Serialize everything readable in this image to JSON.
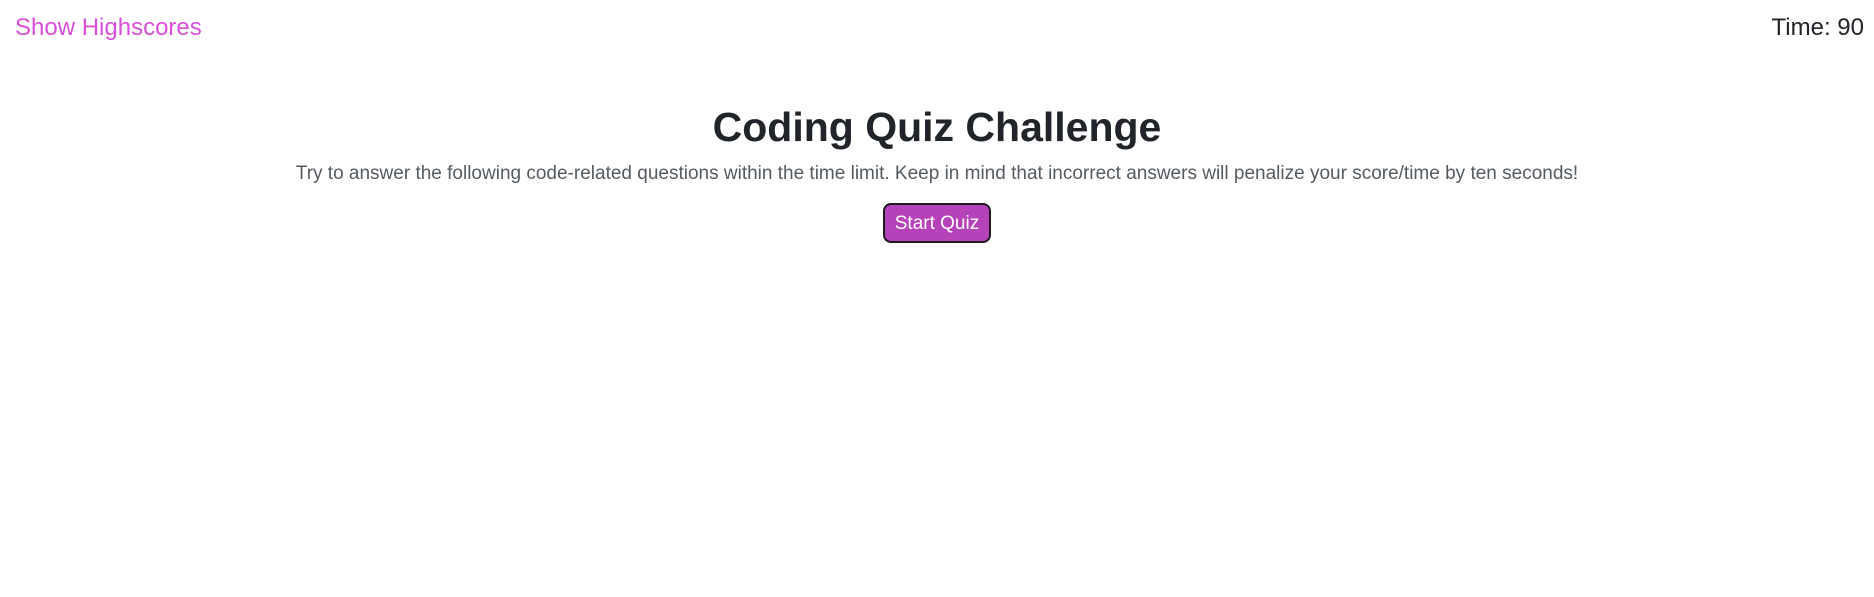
{
  "header": {
    "highscores_link": "Show Highscores",
    "timer_label": "Time: ",
    "timer_value": "90"
  },
  "main": {
    "title": "Coding Quiz Challenge",
    "description": "Try to answer the following code-related questions within the time limit. Keep in mind that incorrect answers will penalize your score/time by ten seconds!",
    "start_button": "Start Quiz"
  },
  "colors": {
    "link": "#d94fd9",
    "button_bg": "#b642b9",
    "button_border": "#1f1a1f",
    "text": "#212529",
    "muted_text": "#555b61"
  }
}
